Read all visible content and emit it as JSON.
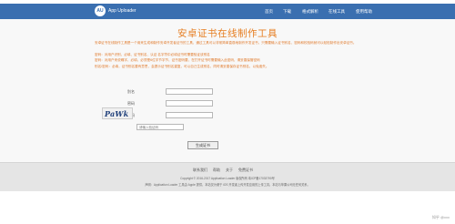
{
  "header": {
    "logo_text": "AU",
    "brand": "App Uploader",
    "nav": [
      "首页",
      "下载",
      "格式解析",
      "在线工具",
      "使用帮助"
    ]
  },
  "main": {
    "title": "安卓证书在线制作工具",
    "description": [
      "安卓证书在线制作工具是一个用来生成和制作安卓开发者证书的工具，通过工具可以非常简单直观地制作开发证书，只需要输入证书别名、密码和校验码就可以轻松制作出安卓证书。",
      "密码：对用户识别、必填、证书别名、认证 名字符中必填证书时需要验证该别名",
      "密码：对用户来说确字、必填，必须是6位字节字节，证书密码要，在打开证书时需要输入此密码，请妥善保管密码",
      "别名/密码：必填，证书别名要有意思，会提示证书别名重复，可以自己生成别名，同时请妥善保存证书别名，以免遗失。"
    ],
    "form": {
      "alias_label": "别名",
      "password_label": "密码",
      "confirm_label": "重复密码",
      "captcha_text": "PaWk",
      "captcha_placeholder": "请输入验证码",
      "submit_label": "生成证书"
    }
  },
  "footer": {
    "links": [
      "联系我们",
      "帮助",
      "关于",
      "免费证书"
    ],
    "line1": "Copyright © 2016-2017 Application Loader 版权所有 粤ICP备17033790号",
    "line2": "声明：Application Loader 工具由 Apple 提供，本站仅为便于 iOS 开发者上传开发应用的上传工具，本站与苹果公司无任何关系。"
  },
  "watermark": "知乎 @xxx"
}
